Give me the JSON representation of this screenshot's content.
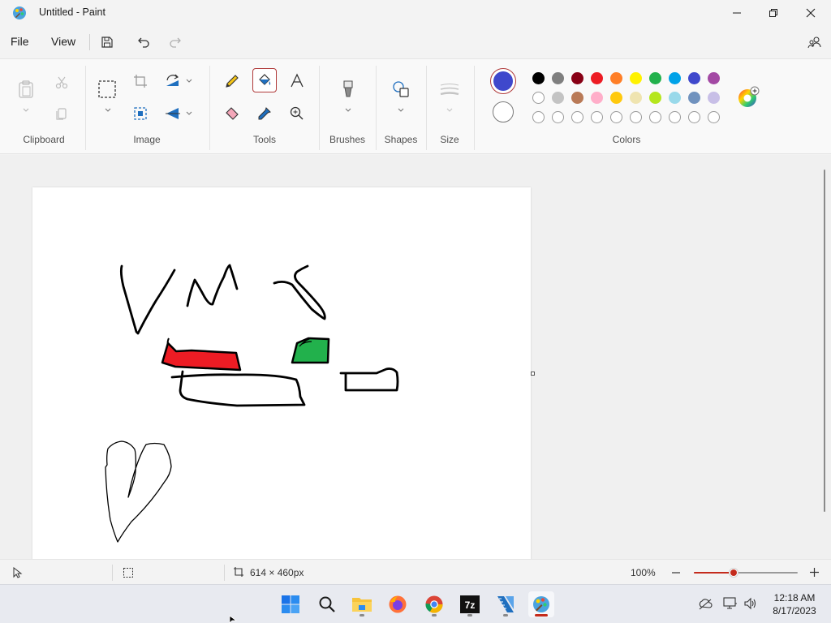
{
  "window": {
    "title": "Untitled - Paint"
  },
  "menu": {
    "file": "File",
    "view": "View"
  },
  "ribbon": {
    "groups": {
      "clipboard": "Clipboard",
      "image": "Image",
      "tools": "Tools",
      "brushes": "Brushes",
      "shapes": "Shapes",
      "size": "Size",
      "colors": "Colors"
    },
    "selected_tool": "fill",
    "primary_color": "#3f48cc",
    "secondary_color": "#ffffff",
    "palette_row1": [
      "#000000",
      "#7f7f7f",
      "#880015",
      "#ed1c24",
      "#ff7f27",
      "#fff200",
      "#22b14c",
      "#00a2e8",
      "#3f48cc",
      "#a349a4"
    ],
    "palette_row2": [
      "#ffffff",
      "#c3c3c3",
      "#b97a57",
      "#ffaec9",
      "#ffc90e",
      "#efe4b0",
      "#b5e61d",
      "#99d9ea",
      "#7092be",
      "#c8bfe7"
    ],
    "palette_row3_empty": 10
  },
  "status": {
    "canvas_size": "614 × 460px",
    "zoom": "100%",
    "zoom_level": 0.38
  },
  "taskbar": {
    "time": "12:18 AM",
    "date": "8/17/2023",
    "apps": [
      "windows-start",
      "search",
      "file-explorer",
      "firefox",
      "chrome",
      "7zip",
      "app-ruler",
      "paint"
    ]
  }
}
